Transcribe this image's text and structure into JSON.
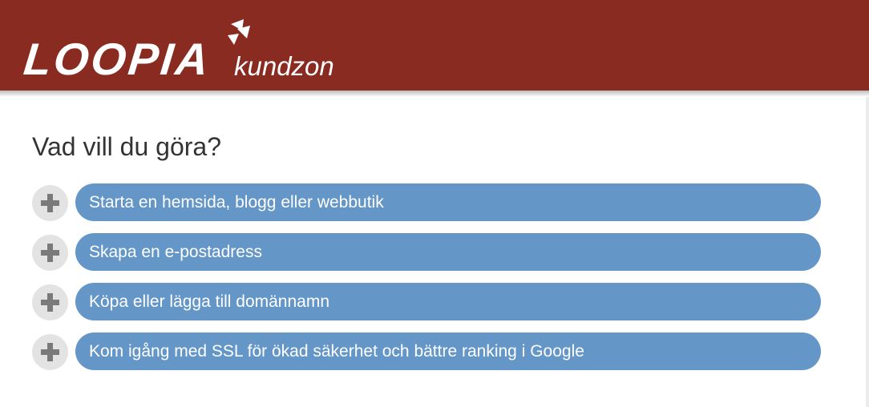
{
  "header": {
    "logo_word": "LOOPIA",
    "logo_sub": "kundzon",
    "background_color": "#8a2b22"
  },
  "main": {
    "title": "Vad vill du göra?",
    "options": [
      {
        "label": "Starta en hemsida, blogg eller webbutik",
        "icon": "plus-icon"
      },
      {
        "label": "Skapa en e-postadress",
        "icon": "plus-icon"
      },
      {
        "label": "Köpa eller lägga till domännamn",
        "icon": "plus-icon"
      },
      {
        "label": "Kom igång med SSL för ökad säkerhet och bättre ranking i Google",
        "icon": "plus-icon"
      }
    ],
    "pill_color": "#6496c8",
    "icon_circle_color": "#e3e3e3"
  }
}
